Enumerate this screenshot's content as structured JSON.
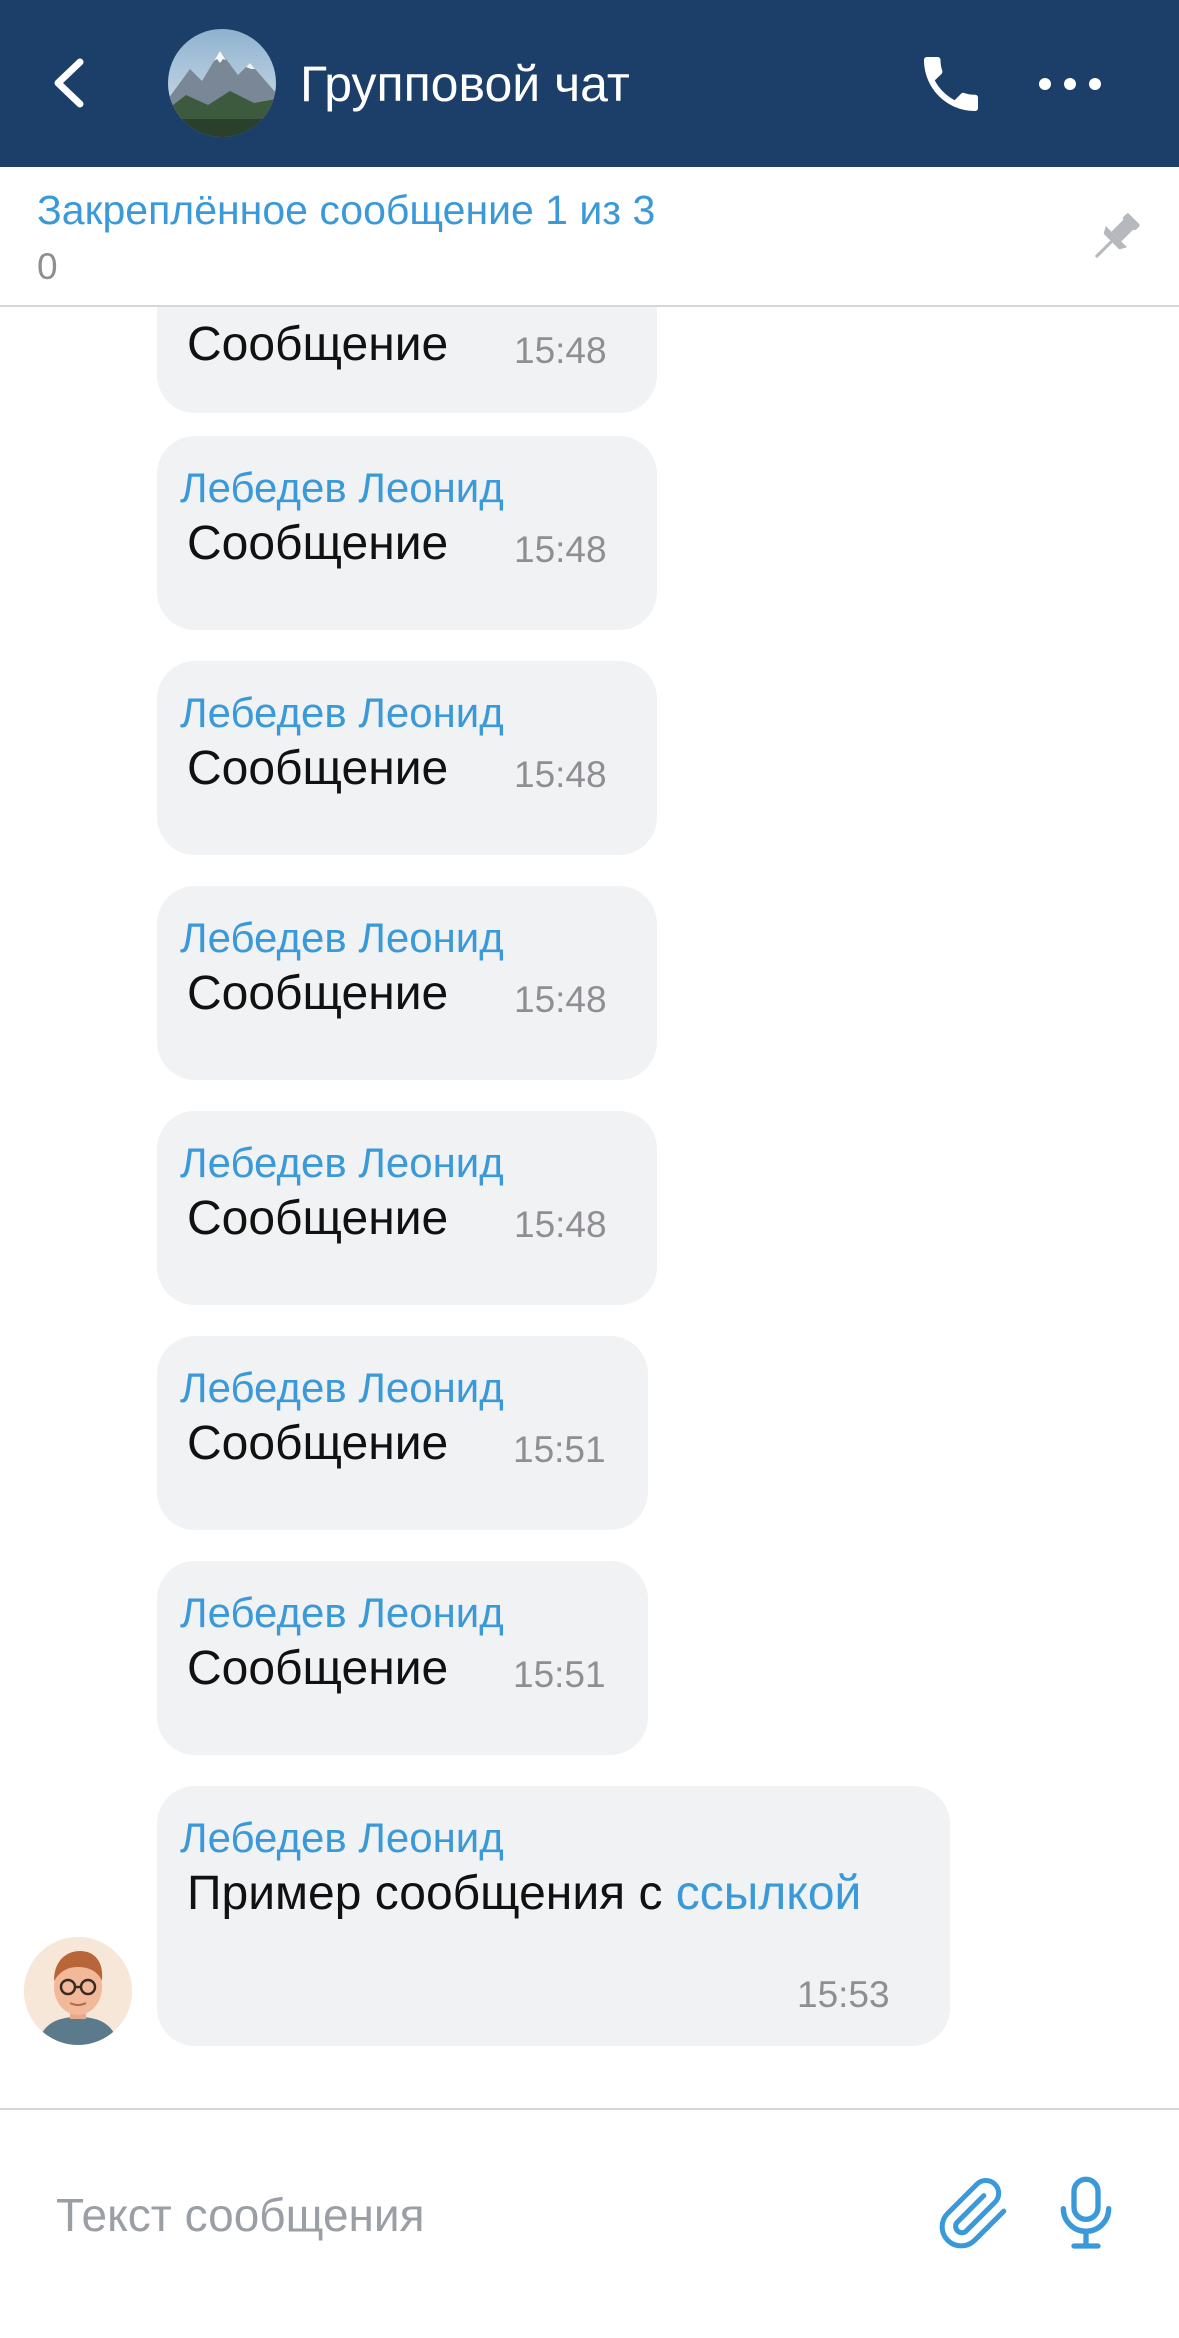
{
  "header": {
    "title": "Групповой чат",
    "back_icon": "chevron-left-icon",
    "call_icon": "phone-icon",
    "more_icon": "more-horizontal-icon",
    "background": "#1b3f68"
  },
  "pinned": {
    "title": "Закреплённое сообщение 1 из 3",
    "text": "0",
    "icon": "pin-icon"
  },
  "messages": [
    {
      "author": "",
      "text": "Сообщение",
      "time": "15:48"
    },
    {
      "author": "Лебедев Леонид",
      "text": "Сообщение",
      "time": "15:48"
    },
    {
      "author": "Лебедев Леонид",
      "text": "Сообщение",
      "time": "15:48"
    },
    {
      "author": "Лебедев Леонид",
      "text": "Сообщение",
      "time": "15:48"
    },
    {
      "author": "Лебедев Леонид",
      "text": "Сообщение",
      "time": "15:48"
    },
    {
      "author": "Лебедев Леонид",
      "text": "Сообщение",
      "time": "15:51"
    },
    {
      "author": "Лебедев Леонид",
      "text": "Сообщение",
      "time": "15:51"
    },
    {
      "author": "Лебедев Леонид",
      "text_before": "Пример сообщения с ",
      "link": "ссылкой",
      "time": "15:53"
    }
  ],
  "input": {
    "placeholder": "Текст сообщения",
    "attach_icon": "paperclip-icon",
    "mic_icon": "microphone-icon"
  },
  "colors": {
    "accent": "#3a9ad9",
    "bubble": "#f1f2f4",
    "time": "#8e8e93"
  }
}
